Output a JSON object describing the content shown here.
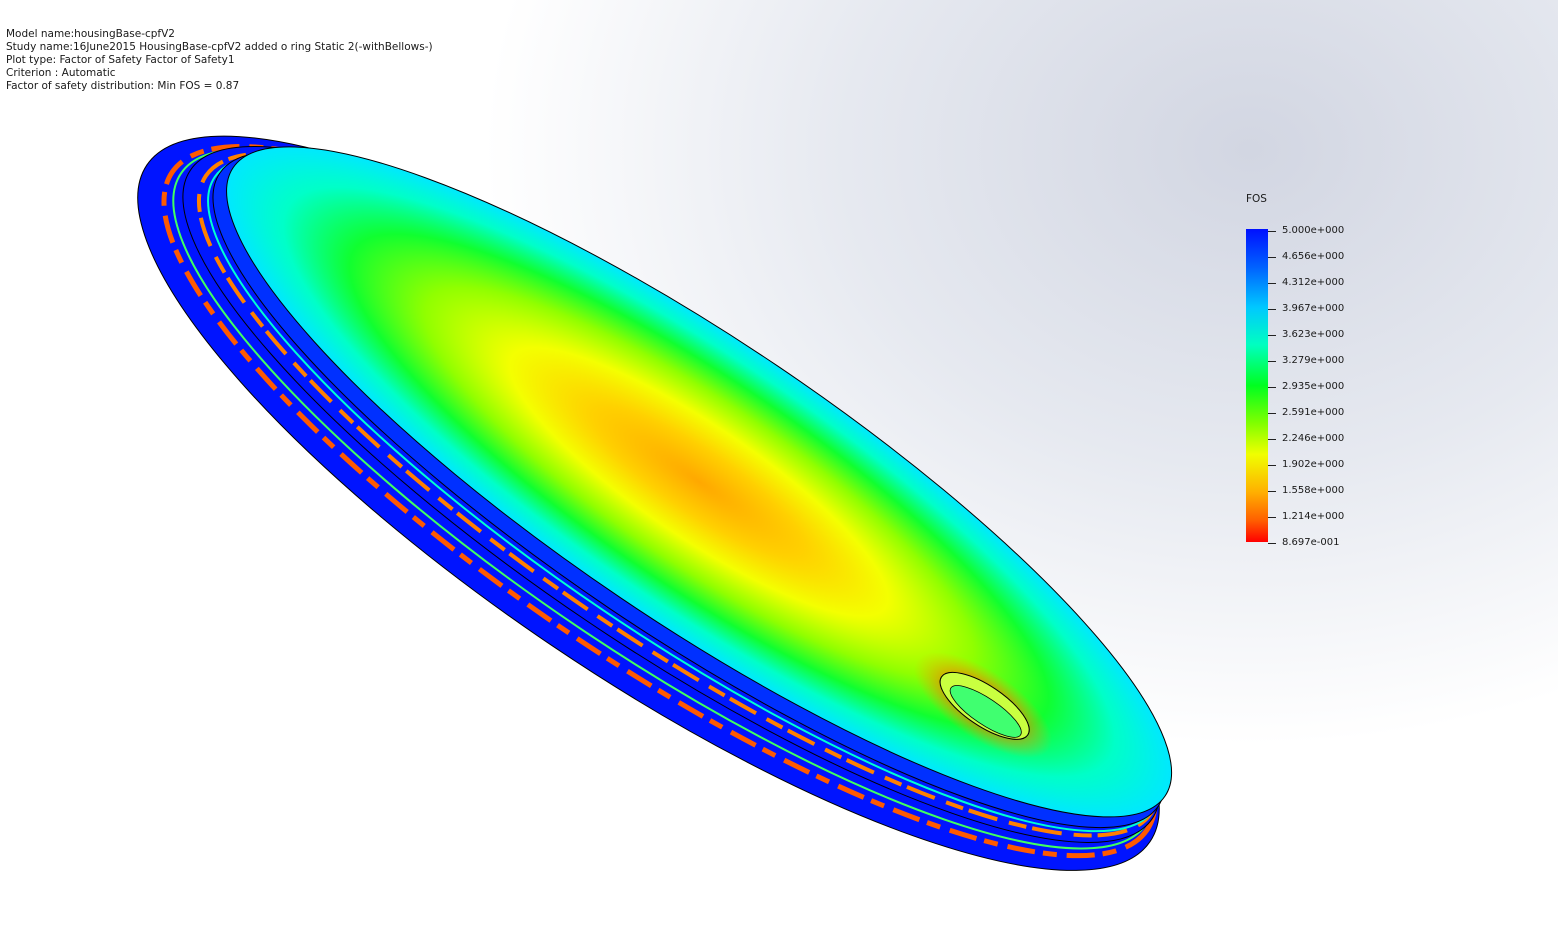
{
  "header": {
    "model_name": "Model name:housingBase-cpfV2",
    "study_name": "Study name:16June2015 HousingBase-cpfV2 added o ring Static 2(-withBellows-)",
    "plot_type": "Plot type: Factor of Safety Factor of Safety1",
    "criterion": "Criterion : Automatic",
    "distribution": "Factor of safety distribution: Min FOS = 0.87"
  },
  "legend": {
    "title": "FOS",
    "labels": [
      "5.000e+000",
      "4.656e+000",
      "4.312e+000",
      "3.967e+000",
      "3.623e+000",
      "3.279e+000",
      "2.935e+000",
      "2.591e+000",
      "2.246e+000",
      "1.902e+000",
      "1.558e+000",
      "1.214e+000",
      "8.697e-001"
    ]
  },
  "colors": {
    "max_fos": "#0010ff",
    "mid_fos": "#00ff20",
    "min_fos": "#ff0000"
  }
}
